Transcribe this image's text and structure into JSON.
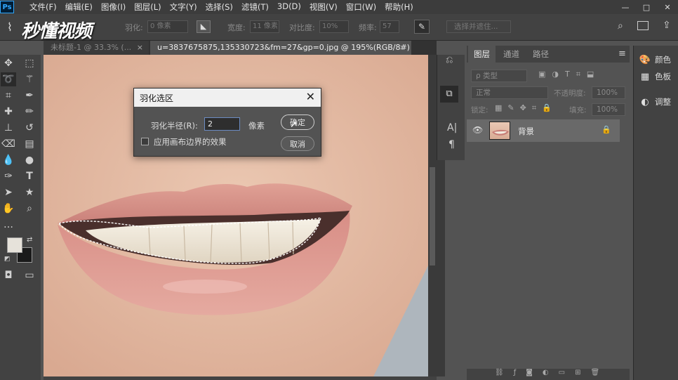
{
  "app": {
    "logo": "Ps"
  },
  "menu": [
    "文件(F)",
    "编辑(E)",
    "图像(I)",
    "图层(L)",
    "文字(Y)",
    "选择(S)",
    "滤镜(T)",
    "3D(D)",
    "视图(V)",
    "窗口(W)",
    "帮助(H)"
  ],
  "window_controls": [
    "—",
    "□",
    "✕"
  ],
  "options": {
    "feather_label": "羽化:",
    "feather_value": "0 像素",
    "width_label": "宽度:",
    "width_value": "11 像素",
    "contrast_label": "对比度:",
    "contrast_value": "10%",
    "frequency_label": "频率:",
    "frequency_value": "57",
    "select_mask": "选择并遮住..."
  },
  "watermark": "秒懂视频",
  "tabs": [
    {
      "label": "未标题-1 @ 33.3% (...",
      "close": "×"
    },
    {
      "label": "u=3837675875,135330723&fm=27&gp=0.jpg @ 195%(RGB/8#)",
      "close": "×"
    }
  ],
  "dialog": {
    "title": "羽化选区",
    "close": "✕",
    "radius_label": "羽化半径(R):",
    "radius_value": "2",
    "unit": "像素",
    "ok": "确定",
    "cancel": "取消",
    "apply_edges": "应用画布边界的效果",
    "apply_edges_checked": false
  },
  "layers_panel": {
    "tabs": [
      "图层",
      "通道",
      "路径"
    ],
    "active_tab": "图层",
    "filter_placeholder": "ρ 类型",
    "blend_mode": "正常",
    "opacity_label": "不透明度:",
    "opacity_value": "100%",
    "lock_label": "锁定:",
    "fill_label": "填充:",
    "fill_value": "100%",
    "layers": [
      {
        "name": "背景",
        "visible": true,
        "locked": true
      }
    ]
  },
  "right_panel": {
    "items": [
      "颜色",
      "色板",
      "调整"
    ]
  },
  "colors": {
    "foreground": "#e6e2da",
    "background": "#1a1a1a",
    "accent": "#31a8ff"
  }
}
